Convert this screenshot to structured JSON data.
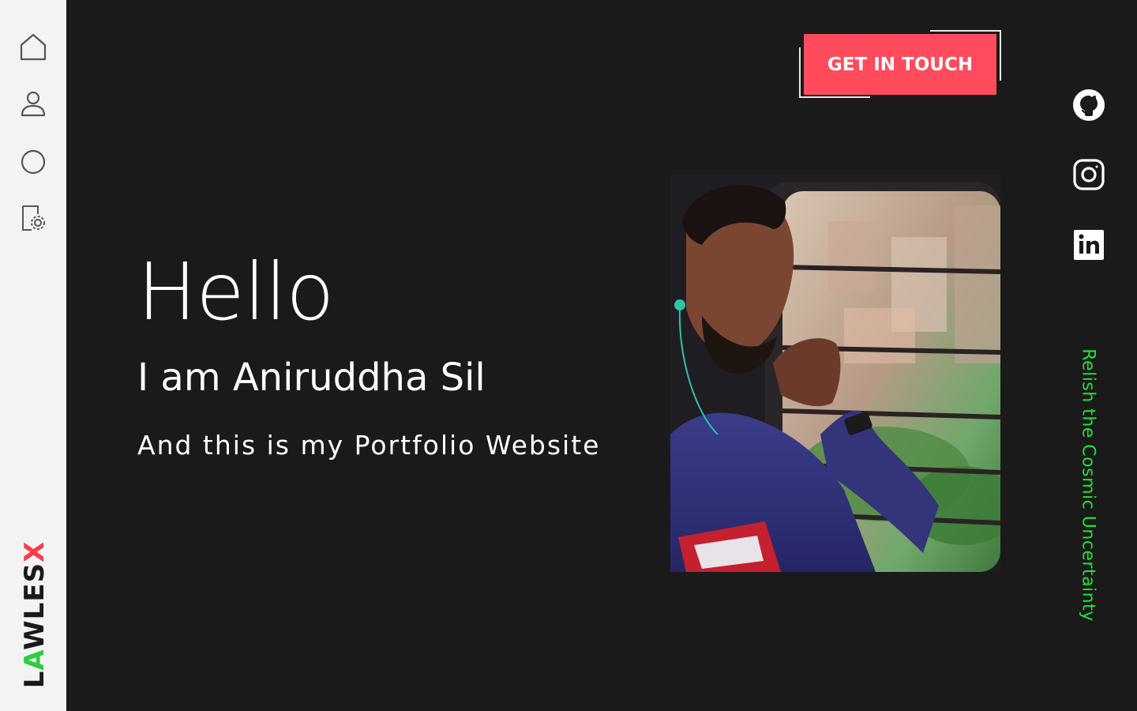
{
  "sidebar": {
    "nav": [
      {
        "icon": "home-icon"
      },
      {
        "icon": "user-icon"
      },
      {
        "icon": "circle-icon"
      },
      {
        "icon": "settings-document-icon"
      }
    ],
    "logo": {
      "text_start": "L",
      "text_green": "A",
      "text_mid": "WLES",
      "text_red": "X",
      "colors": {
        "dark": "#1a1a1a",
        "green": "#2ecc40",
        "red": "#ff3b4a"
      }
    }
  },
  "hero": {
    "greeting": "Hello",
    "intro": "I am Aniruddha Sil",
    "subtitle": "And this is my Portfolio Website"
  },
  "cta": {
    "label": "GET IN TOUCH",
    "color": "#ff4b5c"
  },
  "photo": {
    "alt": "Portrait photo of a young man looking out a train window"
  },
  "social": [
    {
      "icon": "github-icon"
    },
    {
      "icon": "instagram-icon"
    },
    {
      "icon": "linkedin-icon"
    }
  ],
  "tagline": {
    "text": "Relish the Cosmic Uncertainty",
    "color": "#22e03a"
  },
  "theme": {
    "background": "#1a1a1a",
    "sidebar": "#f3f3f3"
  }
}
